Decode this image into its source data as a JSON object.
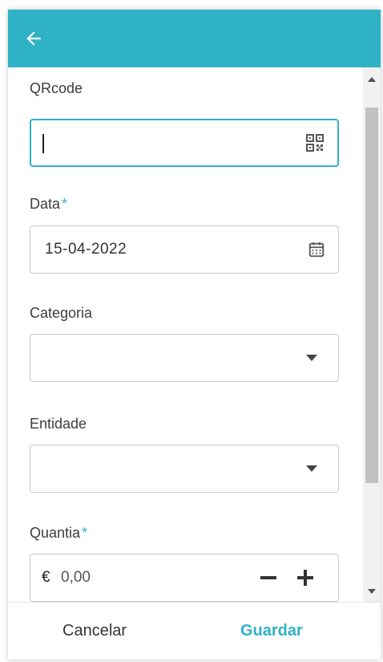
{
  "colors": {
    "accent": "#30b2c6",
    "label": "#3c3c3c",
    "border": "#c9c9c9"
  },
  "header": {
    "back_icon": "arrow-left-icon"
  },
  "form": {
    "qrcode": {
      "label": "QRcode",
      "value": "",
      "icon": "qr-code-icon"
    },
    "data": {
      "label": "Data",
      "required_mark": "*",
      "value": "15-04-2022",
      "icon": "calendar-icon"
    },
    "categoria": {
      "label": "Categoria",
      "value": "",
      "icon": "dropdown-arrow-icon"
    },
    "entidade": {
      "label": "Entidade",
      "value": "",
      "icon": "dropdown-arrow-icon"
    },
    "quantia": {
      "label": "Quantia",
      "required_mark": "*",
      "currency": "€",
      "value": "0,00",
      "decrement_icon": "minus-icon",
      "increment_icon": "plus-icon"
    }
  },
  "footer": {
    "cancel_label": "Cancelar",
    "save_label": "Guardar"
  }
}
